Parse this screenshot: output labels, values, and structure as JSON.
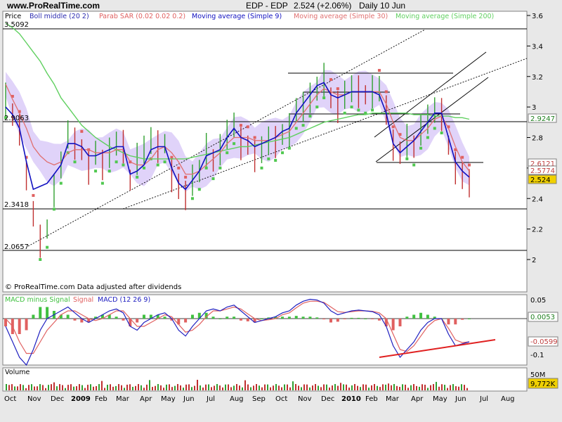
{
  "header": {
    "site": "www.ProRealTime.com",
    "ticker": "EDP - EDP",
    "quote": "2.524 (+2.06%)",
    "period": "Daily  10 Jun"
  },
  "price_panel": {
    "legend": [
      {
        "label": "Price",
        "color": "#000000"
      },
      {
        "label": "Boll middle (20 2)",
        "color": "#2b2bb0"
      },
      {
        "label": "Parab SAR (0.02 0.02 0.2)",
        "color": "#e06060"
      },
      {
        "label": "Moving average (Simple 9)",
        "color": "#1010c0"
      },
      {
        "label": "Moving average (Simple 30)",
        "color": "#e07070"
      },
      {
        "label": "Moving average (Simple 200)",
        "color": "#60d060"
      }
    ],
    "level_labels": [
      "3.5092",
      "2.9063",
      "2.3418",
      "2.0657"
    ],
    "right_tags": [
      {
        "label": "2.9247",
        "value": 2.9247,
        "bg": "#ffffff",
        "fg": "#208020"
      },
      {
        "label": "2.6121",
        "value": 2.6121,
        "bg": "#ffffff",
        "fg": "#c04040"
      },
      {
        "label": "2.5774",
        "value": 2.5774,
        "bg": "#ffffff",
        "fg": "#c04040"
      },
      {
        "label": "2.524",
        "value": 2.524,
        "bg": "#f0d000",
        "fg": "#000000"
      }
    ],
    "yticks": [
      "3.6",
      "3.4",
      "3.2",
      "3",
      "2.8",
      "2.6",
      "2.4",
      "2.2",
      "2"
    ],
    "footer": "© ProRealTime.com Data adjusted after dividends"
  },
  "macd_panel": {
    "legend": [
      {
        "label": "MACD minus Signal",
        "color": "#40c040"
      },
      {
        "label": "Signal",
        "color": "#e06060"
      },
      {
        "label": "MACD (12 26 9)",
        "color": "#2020c0"
      }
    ],
    "yticks": [
      "0.05",
      "-0.1"
    ],
    "right_tags": [
      {
        "label": "0.0053",
        "bg": "#ffffff",
        "fg": "#208020"
      },
      {
        "label": "-0.0599",
        "bg": "#ffffff",
        "fg": "#c04040"
      }
    ]
  },
  "volume_panel": {
    "label": "Volume",
    "ytick": "50M",
    "right_tag": {
      "label": "9,772K",
      "bg": "#f0d000",
      "fg": "#000000"
    }
  },
  "x_axis": [
    "Oct",
    "Nov",
    "Dec",
    "2009",
    "Feb",
    "Mar",
    "Apr",
    "May",
    "Jun",
    "Jul",
    "Aug",
    "Sep",
    "Oct",
    "Nov",
    "Dec",
    "2010",
    "Feb",
    "Mar",
    "Apr",
    "May",
    "Jun",
    "Jul",
    "Aug"
  ],
  "colors": {
    "bg": "#e8e8e8",
    "panel": "#ffffff",
    "band": "#d8c8f8",
    "price": "#000000"
  },
  "chart_data": [
    {
      "type": "line",
      "ylim": [
        1.9,
        3.65
      ],
      "price": [
        3.05,
        2.95,
        2.85,
        2.55,
        2.3,
        2.12,
        2.2,
        2.45,
        2.62,
        2.82,
        2.76,
        2.72,
        2.6,
        2.7,
        2.62,
        2.7,
        2.76,
        2.74,
        2.52,
        2.66,
        2.72,
        2.78,
        2.74,
        2.76,
        2.55,
        2.48,
        2.42,
        2.52,
        2.58,
        2.72,
        2.65,
        2.72,
        2.82,
        2.88,
        2.76,
        2.75,
        2.68,
        2.72,
        2.78,
        2.77,
        2.82,
        2.85,
        2.98,
        3.0,
        3.06,
        3.12,
        3.18,
        3.06,
        3.0,
        3.08,
        3.12,
        3.1,
        3.08,
        3.1,
        3.12,
        2.98,
        2.75,
        2.7,
        2.78,
        2.74,
        2.85,
        2.92,
        2.98,
        2.95,
        2.75,
        2.6,
        2.55,
        2.5
      ],
      "sma9": [
        3.0,
        2.95,
        2.86,
        2.64,
        2.46,
        2.48,
        2.5,
        2.56,
        2.62,
        2.76,
        2.76,
        2.74,
        2.68,
        2.68,
        2.7,
        2.72,
        2.74,
        2.74,
        2.56,
        2.58,
        2.62,
        2.72,
        2.74,
        2.74,
        2.6,
        2.5,
        2.46,
        2.52,
        2.58,
        2.68,
        2.7,
        2.72,
        2.8,
        2.86,
        2.8,
        2.78,
        2.74,
        2.76,
        2.78,
        2.8,
        2.84,
        2.86,
        2.96,
        3.02,
        3.08,
        3.14,
        3.16,
        3.08,
        3.06,
        3.08,
        3.1,
        3.1,
        3.1,
        3.1,
        3.08,
        2.96,
        2.76,
        2.7,
        2.74,
        2.78,
        2.84,
        2.9,
        2.96,
        2.96,
        2.8,
        2.64,
        2.58,
        2.54
      ],
      "sma30": [
        3.15,
        3.05,
        2.96,
        2.86,
        2.74,
        2.68,
        2.64,
        2.62,
        2.64,
        2.7,
        2.72,
        2.72,
        2.72,
        2.7,
        2.7,
        2.7,
        2.72,
        2.72,
        2.64,
        2.62,
        2.62,
        2.66,
        2.72,
        2.74,
        2.7,
        2.64,
        2.56,
        2.56,
        2.58,
        2.62,
        2.66,
        2.7,
        2.76,
        2.8,
        2.8,
        2.8,
        2.78,
        2.78,
        2.78,
        2.8,
        2.82,
        2.84,
        2.9,
        2.96,
        3.02,
        3.08,
        3.12,
        3.1,
        3.08,
        3.08,
        3.1,
        3.1,
        3.1,
        3.1,
        3.1,
        3.02,
        2.9,
        2.8,
        2.78,
        2.78,
        2.82,
        2.86,
        2.92,
        2.94,
        2.86,
        2.74,
        2.64,
        2.58
      ],
      "sma200": [
        3.55,
        3.52,
        3.48,
        3.42,
        3.36,
        3.3,
        3.22,
        3.15,
        3.06,
        3.0,
        2.94,
        2.88,
        2.84,
        2.8,
        2.77,
        2.74,
        2.72,
        2.7,
        2.68,
        2.67,
        2.66,
        2.66,
        2.66,
        2.66,
        2.66,
        2.66,
        2.66,
        2.67,
        2.68,
        2.69,
        2.7,
        2.71,
        2.72,
        2.73,
        2.74,
        2.74,
        2.75,
        2.76,
        2.77,
        2.78,
        2.79,
        2.8,
        2.82,
        2.84,
        2.86,
        2.88,
        2.9,
        2.91,
        2.92,
        2.93,
        2.94,
        2.95,
        2.95,
        2.96,
        2.96,
        2.96,
        2.96,
        2.96,
        2.96,
        2.95,
        2.95,
        2.95,
        2.94,
        2.94,
        2.94,
        2.93,
        2.93,
        2.92
      ]
    },
    {
      "type": "line",
      "ylim": [
        -0.12,
        0.065
      ],
      "macd": [
        -0.02,
        -0.06,
        -0.1,
        -0.12,
        -0.08,
        -0.03,
        0.0,
        0.01,
        0.02,
        0.03,
        0.015,
        0.0,
        -0.01,
        0.0,
        0.01,
        0.02,
        0.025,
        0.015,
        -0.02,
        -0.03,
        -0.01,
        0.0,
        0.01,
        0.015,
        0.0,
        -0.03,
        -0.045,
        -0.02,
        0.0,
        0.02,
        0.025,
        0.02,
        0.03,
        0.035,
        0.02,
        0.005,
        -0.01,
        -0.005,
        0.0,
        0.005,
        0.015,
        0.02,
        0.035,
        0.045,
        0.05,
        0.048,
        0.04,
        0.02,
        0.01,
        0.015,
        0.02,
        0.022,
        0.02,
        0.018,
        0.01,
        -0.02,
        -0.07,
        -0.1,
        -0.08,
        -0.06,
        -0.03,
        -0.01,
        0.0,
        0.0,
        -0.04,
        -0.07,
        -0.065,
        -0.06
      ],
      "signal": [
        0.0,
        -0.02,
        -0.06,
        -0.09,
        -0.09,
        -0.06,
        -0.03,
        -0.01,
        0.01,
        0.02,
        0.02,
        0.01,
        0.0,
        -0.005,
        0.0,
        0.01,
        0.02,
        0.02,
        0.0,
        -0.02,
        -0.02,
        -0.01,
        0.0,
        0.01,
        0.005,
        -0.015,
        -0.035,
        -0.03,
        -0.015,
        0.005,
        0.02,
        0.02,
        0.025,
        0.03,
        0.025,
        0.012,
        0.0,
        -0.005,
        -0.003,
        0.0,
        0.01,
        0.015,
        0.028,
        0.04,
        0.045,
        0.045,
        0.042,
        0.03,
        0.018,
        0.016,
        0.018,
        0.02,
        0.02,
        0.019,
        0.015,
        0.0,
        -0.04,
        -0.08,
        -0.085,
        -0.07,
        -0.045,
        -0.02,
        -0.005,
        0.0,
        -0.025,
        -0.055,
        -0.062,
        -0.06
      ]
    }
  ]
}
